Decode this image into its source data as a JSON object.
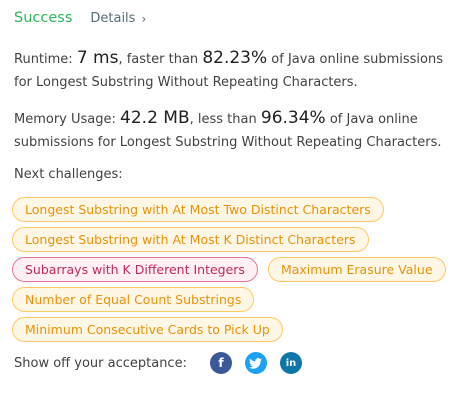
{
  "header": {
    "status": "Success",
    "details_label": "Details",
    "details_chevron": "›"
  },
  "runtime": {
    "label": "Runtime:",
    "value": "7 ms",
    "mid_text": ", faster than",
    "percent": "82.23%",
    "tail_text": "of Java online submissions for Longest Substring Without Repeating Characters."
  },
  "memory": {
    "label": "Memory Usage:",
    "value": "42.2 MB",
    "mid_text": ", less than",
    "percent": "96.34%",
    "tail_text": "of Java online submissions for Longest Substring Without Repeating Characters."
  },
  "next_challenges": {
    "title": "Next challenges:",
    "items": [
      {
        "label": "Longest Substring with At Most Two Distinct Characters",
        "difficulty": "medium"
      },
      {
        "label": "Longest Substring with At Most K Distinct Characters",
        "difficulty": "medium"
      },
      {
        "label": "Subarrays with K Different Integers",
        "difficulty": "hard"
      },
      {
        "label": "Maximum Erasure Value",
        "difficulty": "medium"
      },
      {
        "label": "Number of Equal Count Substrings",
        "difficulty": "medium"
      },
      {
        "label": "Minimum Consecutive Cards to Pick Up",
        "difficulty": "medium"
      }
    ]
  },
  "share": {
    "label": "Show off your acceptance:",
    "facebook_glyph": "f",
    "twitter_glyph": "t",
    "linkedin_glyph": "in"
  },
  "colors": {
    "success": "#2db55d",
    "medium_chip_text": "#e8920a",
    "hard_chip_text": "#c0285f",
    "facebook": "#3b5998",
    "twitter": "#1da1f2",
    "linkedin": "#0e76a8"
  },
  "icons": {
    "details_chevron": "chevron-right-icon",
    "facebook": "facebook-icon",
    "twitter": "twitter-icon",
    "linkedin": "linkedin-icon"
  }
}
